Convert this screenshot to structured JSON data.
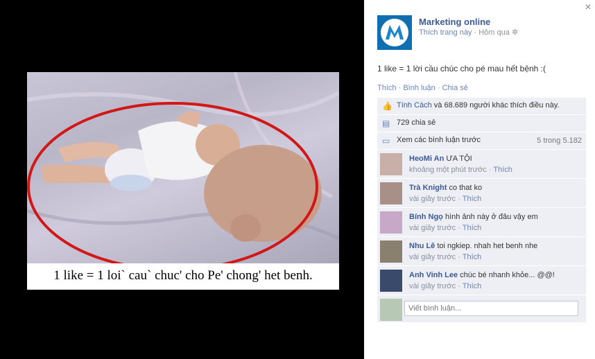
{
  "photo": {
    "caption": "1 like = 1 loi` cau` chuc' cho Pe' chong' het benh."
  },
  "page": {
    "name": "Marketing online",
    "like_page": "Thích trang này",
    "time": "Hôm qua",
    "settings_icon": "gear-icon"
  },
  "post": {
    "text": "1 like = 1 lời cầu chúc cho pé mau hết bệnh :("
  },
  "actions": {
    "like": "Thích",
    "comment": "Bình luận",
    "share": "Chia sẻ"
  },
  "ufi": {
    "likes_name": "Tính Cách",
    "likes_rest": " và 68.689 người khác thích điều này.",
    "shares": "729 chia sẻ",
    "view_previous": "Xem các bình luận trước",
    "count": "5 trong 5.182"
  },
  "comments": [
    {
      "name": "HeoMi An",
      "text": "ƯA TỘI",
      "time": "khoảng một phút trước",
      "like": "Thích",
      "avatar_color": "#c8b0a8"
    },
    {
      "name": "Trà Knight",
      "text": "co that ko",
      "time": "vài giây trước",
      "like": "Thích",
      "avatar_color": "#a88f87"
    },
    {
      "name": "Bính Ngọ",
      "text": "hình ảnh này ở đâu vậy em",
      "time": "vài giây trước",
      "like": "Thích",
      "avatar_color": "#c8a8c8"
    },
    {
      "name": "Nhu Lê",
      "text": "toi ngkiep. nhah het benh nhe",
      "time": "vài giây trước",
      "like": "Thích",
      "avatar_color": "#8a8070"
    },
    {
      "name": "Anh Vinh Lee",
      "text": "chúc bé nhanh khỏe... @@!",
      "time": "vài giây trước",
      "like": "Thích",
      "avatar_color": "#3a4a6a"
    }
  ],
  "composer": {
    "placeholder": "Viết bình luận..."
  }
}
